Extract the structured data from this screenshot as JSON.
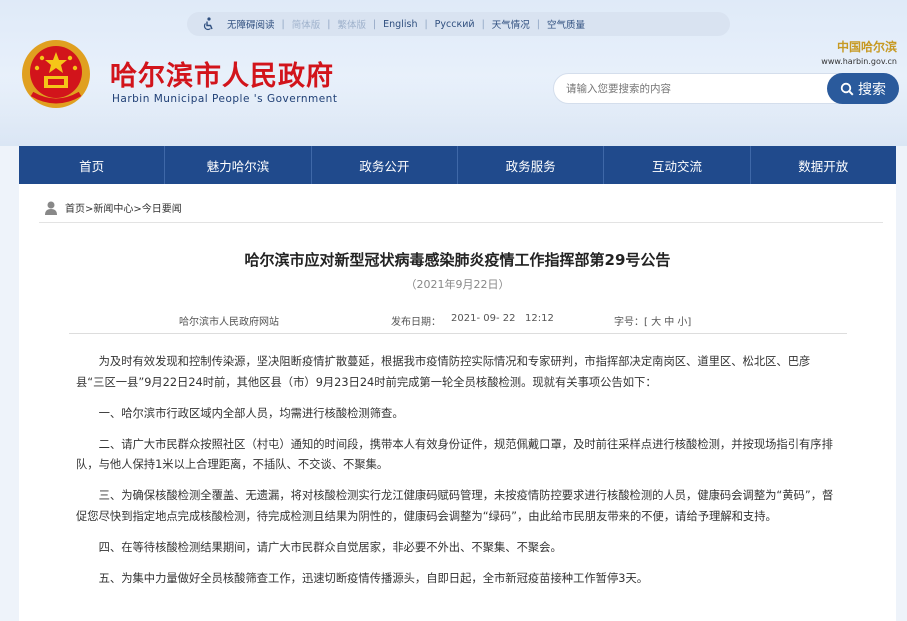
{
  "topbar": {
    "items": [
      "无障碍阅读",
      "简体版",
      "繁体版",
      "English",
      "Русский",
      "天气情况",
      "空气质量"
    ]
  },
  "header": {
    "title": "哈尔滨市人民政府",
    "subtitle": "Harbin Municipal People 's Government",
    "logo_cn": "中国哈尔滨",
    "logo_url": "www.harbin.gov.cn",
    "emblem_color": "#d2141b"
  },
  "search": {
    "placeholder": "请输入您要搜索的内容",
    "button_label": "搜索"
  },
  "nav": [
    "首页",
    "魅力哈尔滨",
    "政务公开",
    "政务服务",
    "互动交流",
    "数据开放"
  ],
  "breadcrumb": "首页>新闻中心>今日要闻",
  "article": {
    "title": "哈尔滨市应对新型冠状病毒感染肺炎疫情工作指挥部第29号公告",
    "date": "（2021年9月22日）",
    "source": "哈尔滨市人民政府网站",
    "published_label": "发布日期：",
    "published_value": "2021- 09- 22   12:12",
    "font_size_label": "字号：[ 大 中 小]",
    "paragraphs": [
      "为及时有效发现和控制传染源，坚决阻断疫情扩散蔓延，根据我市疫情防控实际情况和专家研判，市指挥部决定南岗区、道里区、松北区、巴彦县“三区一县”9月22日24时前，其他区县（市）9月23日24时前完成第一轮全员核酸检测。现就有关事项公告如下：",
      "一、哈尔滨市行政区域内全部人员，均需进行核酸检测筛查。",
      "二、请广大市民群众按照社区（村屯）通知的时间段，携带本人有效身份证件，规范佩戴口罩，及时前往采样点进行核酸检测，并按现场指引有序排队，与他人保持1米以上合理距离，不插队、不交谈、不聚集。",
      "三、为确保核酸检测全覆盖、无遗漏，将对核酸检测实行龙江健康码赋码管理，未按疫情防控要求进行核酸检测的人员，健康码会调整为“黄码”，督促您尽快到指定地点完成核酸检测，待完成检测且结果为阴性的，健康码会调整为“绿码”，由此给市民朋友带来的不便，请给予理解和支持。",
      "四、在等待核酸检测结果期间，请广大市民群众自觉居家，非必要不外出、不聚集、不聚会。",
      "五、为集中力量做好全员核酸筛查工作，迅速切断疫情传播源头，自即日起，全市新冠疫苗接种工作暂停3天。"
    ]
  },
  "colors": {
    "nav_bg": "#204a8c",
    "title_red": "#d2141b",
    "search_btn": "#2a5a9c"
  }
}
